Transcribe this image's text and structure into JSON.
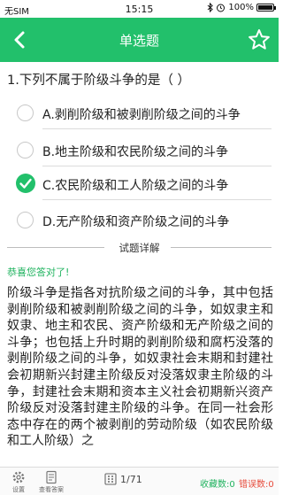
{
  "status_bar": {
    "carrier": "无SIM",
    "time": "15:15",
    "battery": "100%"
  },
  "nav": {
    "title": "单选题"
  },
  "question": {
    "text": "1.下列不属于阶级斗争的是（ ）"
  },
  "options": [
    {
      "label": "A.剥削阶级和被剥削阶级之间的斗争",
      "selected": false
    },
    {
      "label": "B.地主阶级和农民阶级之间的斗争",
      "selected": false
    },
    {
      "label": "C.农民阶级和工人阶级之间的斗争",
      "selected": true
    },
    {
      "label": "D.无产阶级和资产阶级之间的斗争",
      "selected": false
    }
  ],
  "detail": {
    "heading": "试题详解",
    "correct_message": "恭喜您答对了!",
    "explanation": "阶级斗争是指各对抗阶级之间的斗争，其中包括剥削阶级和被剥削阶级之间的斗争，如奴隶主和奴隶、地主和农民、资产阶级和无产阶级之间的斗争；也包括上升时期的剥削阶级和腐朽没落的剥削阶级之间的斗争，如奴隶社会末期和封建社会初期新兴封建主阶级反对没落奴隶主阶级的斗争，封建社会末期和资本主义社会初期新兴资产阶级反对没落封建主阶级的斗争。在同一社会形态中存在的两个被剥削的劳动阶级（如农民阶级和工人阶级）之"
  },
  "footer": {
    "settings_label": "设置",
    "answer_label": "查看答案",
    "page": "1/71",
    "collect_label": "收藏数:0",
    "wrong_label": "错误数:0"
  },
  "colors": {
    "accent": "#22c06b",
    "correct_text": "#20b35f",
    "wrong_text": "#e74c3c"
  }
}
